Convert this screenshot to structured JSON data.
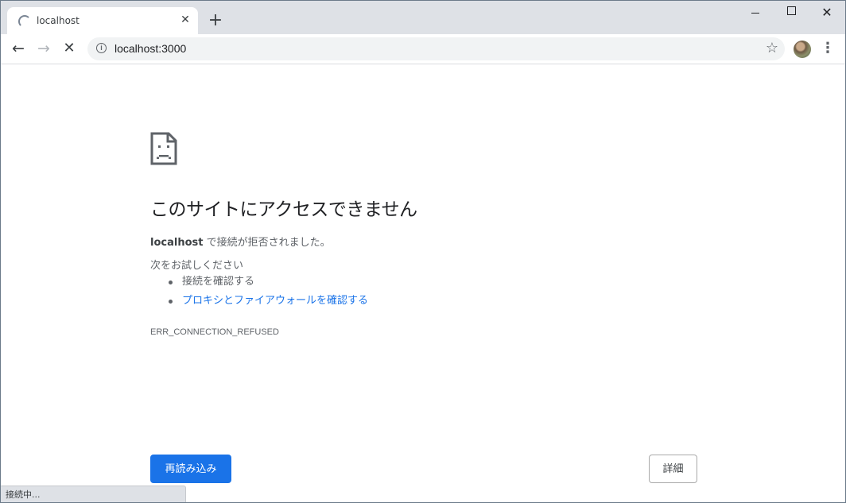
{
  "browser": {
    "tab": {
      "title": "localhost",
      "close_glyph": "✕"
    },
    "new_tab_glyph": "+",
    "window_controls": {
      "close_glyph": "✕"
    },
    "toolbar": {
      "back_glyph": "←",
      "forward_glyph": "→",
      "stop_glyph": "✕",
      "info_glyph": "i",
      "url": "localhost:3000",
      "star_glyph": "☆",
      "menu_glyph": "⋮"
    },
    "status_text": "接続中..."
  },
  "error_page": {
    "icon": "sad-document-icon",
    "title": "このサイトにアクセスできません",
    "host": "localhost",
    "message_suffix": " で接続が拒否されました。",
    "try_label": "次をお試しください",
    "suggestions": [
      "接続を確認する",
      "プロキシとファイアウォールを確認する"
    ],
    "error_code": "ERR_CONNECTION_REFUSED",
    "reload_label": "再読み込み",
    "details_label": "詳細"
  },
  "colors": {
    "accent": "#1a73e8",
    "tabstrip": "#dee1e6",
    "text_primary": "#202124",
    "text_secondary": "#5f6368"
  }
}
